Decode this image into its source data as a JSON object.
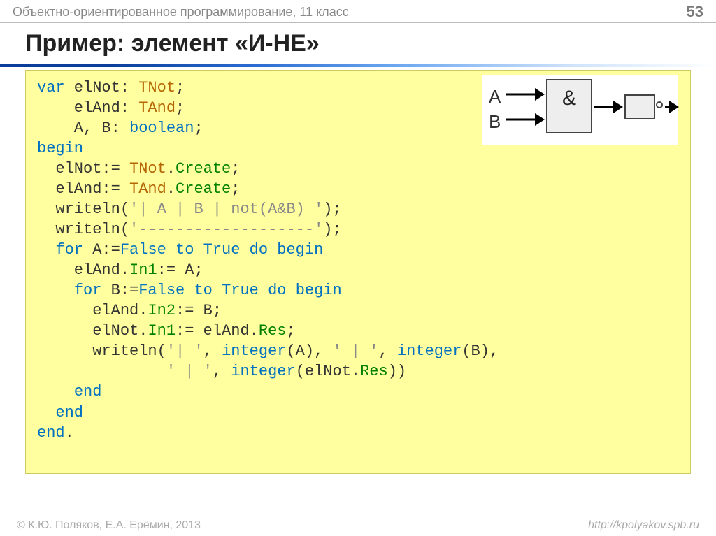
{
  "header": {
    "course": "Объектно-ориентированное программирование, 11 класс",
    "page_number": "53"
  },
  "title": "Пример: элемент «И-НЕ»",
  "diagram": {
    "inputA": "A",
    "inputB": "B",
    "and_symbol": "&"
  },
  "code": {
    "l01a": "var",
    "l01b": " elNot: ",
    "l01c": "TNot",
    "l01d": ";",
    "l02a": "    elAnd: ",
    "l02b": "TAnd",
    "l02c": ";",
    "l03a": "    A, B: ",
    "l03b": "boolean",
    "l03c": ";",
    "l04": "begin",
    "l05a": "  elNot:= ",
    "l05b": "TNot",
    "l05c": ".",
    "l05d": "Create",
    "l05e": ";",
    "l06a": "  elAnd:= ",
    "l06b": "TAnd",
    "l06c": ".",
    "l06d": "Create",
    "l06e": ";",
    "l07a": "  writeln(",
    "l07b": "'| A | B | not(A&B) '",
    "l07c": ");",
    "l08a": "  writeln(",
    "l08b": "'-------------------'",
    "l08c": ");",
    "l09a": "  ",
    "l09b": "for",
    "l09c": " A:=",
    "l09d": "False",
    "l09e": " ",
    "l09f": "to",
    "l09g": " ",
    "l09h": "True",
    "l09i": " ",
    "l09j": "do",
    "l09k": " ",
    "l09l": "begin",
    "l10a": "    elAnd.",
    "l10b": "In1",
    "l10c": ":= A;",
    "l11a": "    ",
    "l11b": "for",
    "l11c": " B:=",
    "l11d": "False",
    "l11e": " ",
    "l11f": "to",
    "l11g": " ",
    "l11h": "True",
    "l11i": " ",
    "l11j": "do",
    "l11k": " ",
    "l11l": "begin",
    "l12a": "      elAnd.",
    "l12b": "In2",
    "l12c": ":= B;",
    "l13a": "      elNot.",
    "l13b": "In1",
    "l13c": ":= elAnd.",
    "l13d": "Res",
    "l13e": ";",
    "l14a": "      writeln(",
    "l14b": "'| '",
    "l14c": ", ",
    "l14d": "integer",
    "l14e": "(A), ",
    "l14f": "' | '",
    "l14g": ", ",
    "l14h": "integer",
    "l14i": "(B),",
    "l15a": "              ",
    "l15b": "' | '",
    "l15c": ", ",
    "l15d": "integer",
    "l15e": "(elNot.",
    "l15f": "Res",
    "l15g": "))",
    "l16a": "    ",
    "l16b": "end",
    "l17a": "  ",
    "l17b": "end",
    "l18a": "end",
    "l18b": "."
  },
  "footer": {
    "copyright": "© К.Ю. Поляков, Е.А. Ерёмин, 2013",
    "site": "http://kpolyakov.spb.ru"
  }
}
